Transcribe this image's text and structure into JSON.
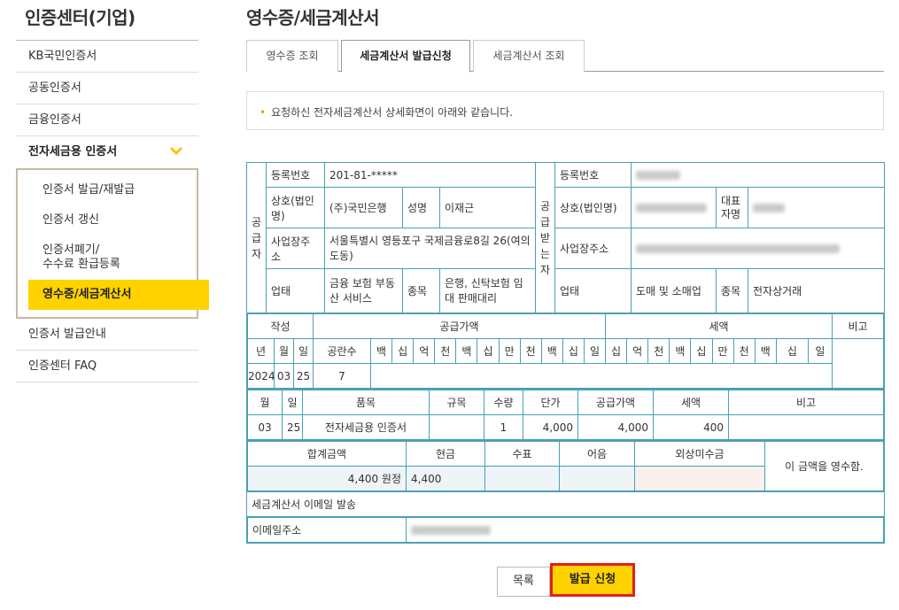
{
  "sidebar": {
    "title": "인증센터(기업)",
    "items": [
      {
        "label": "KB국민인증서"
      },
      {
        "label": "공동인증서"
      },
      {
        "label": "금융인증서"
      },
      {
        "label": "전자세금용 인증서"
      }
    ],
    "sub_items": [
      {
        "label": "인증서 발급/재발급"
      },
      {
        "label": "인증서 갱신"
      },
      {
        "label_line1": "인증서폐기/",
        "label_line2": "수수료 환급등록"
      },
      {
        "label": "영수증/세금계산서"
      }
    ],
    "after_items": [
      {
        "label": "인증서 발급안내"
      },
      {
        "label": "인증센터 FAQ"
      }
    ]
  },
  "page": {
    "title": "영수증/세금계산서",
    "tabs": [
      {
        "label": "영수증 조회"
      },
      {
        "label": "세금계산서 발급신청"
      },
      {
        "label": "세금계산서 조회"
      }
    ],
    "notice": "요청하신 전자세금계산서 상세화면이 아래와 같습니다."
  },
  "invoice": {
    "supplier_label": "공급자",
    "receiver_label": "공급받는자",
    "labels": {
      "reg_no": "등록번호",
      "company": "상호(법인명)",
      "name": "성명",
      "rep_name": "대표자명",
      "address": "사업장주소",
      "biz_type": "업태",
      "biz_item": "종목"
    },
    "supplier": {
      "reg_no": "201-81-*****",
      "company": "(주)국민은행",
      "name": "이재근",
      "address": "서울특별시 영등포구 국제금융로8길 26(여의도동)",
      "biz_type": "금융 보험 부동산 서비스",
      "biz_item": "은행, 신탁보험 임대 판매대리"
    },
    "receiver": {
      "biz_type": "도매 및 소매업",
      "biz_item": "전자상거래"
    },
    "amount_header": {
      "written": "작성",
      "supply_amount": "공급가액",
      "tax": "세액",
      "note": "비고",
      "year": "년",
      "month": "월",
      "day": "일",
      "blank_count": "공란수",
      "digits_supply": [
        "백",
        "십",
        "억",
        "천",
        "백",
        "십",
        "만",
        "천",
        "백",
        "십",
        "일"
      ],
      "digits_tax": [
        "십",
        "억",
        "천",
        "백",
        "십",
        "만",
        "천",
        "백",
        "십",
        "일"
      ]
    },
    "amount_row": {
      "year": "2024",
      "month": "03",
      "day": "25",
      "blank_count": "7"
    },
    "item_header": {
      "month": "월",
      "day": "일",
      "item": "품목",
      "spec": "규목",
      "qty": "수량",
      "unit_price": "단가",
      "supply_amount": "공급가액",
      "tax": "세액",
      "note": "비고"
    },
    "item_row": {
      "month": "03",
      "day": "25",
      "item": "전자세금용 인증서",
      "spec": "",
      "qty": "1",
      "unit_price": "4,000",
      "supply_amount": "4,000",
      "tax": "400",
      "note": ""
    },
    "totals": {
      "total_label": "합계금액",
      "cash_label": "현금",
      "check_label": "수표",
      "note_label": "어음",
      "credit_label": "외상미수금",
      "total_value": "4,400 원정",
      "cash_value": "4,400",
      "receipt_text": "이 금액을 영수함."
    },
    "email_section": "세금계산서 이메일 발송",
    "email_label": "이메일주소"
  },
  "buttons": {
    "list": "목록",
    "apply": "발급 신청"
  },
  "colors": {
    "accent": "#ffd200",
    "table_border": "#4aa0b5",
    "highlight_border": "#e0201f"
  }
}
